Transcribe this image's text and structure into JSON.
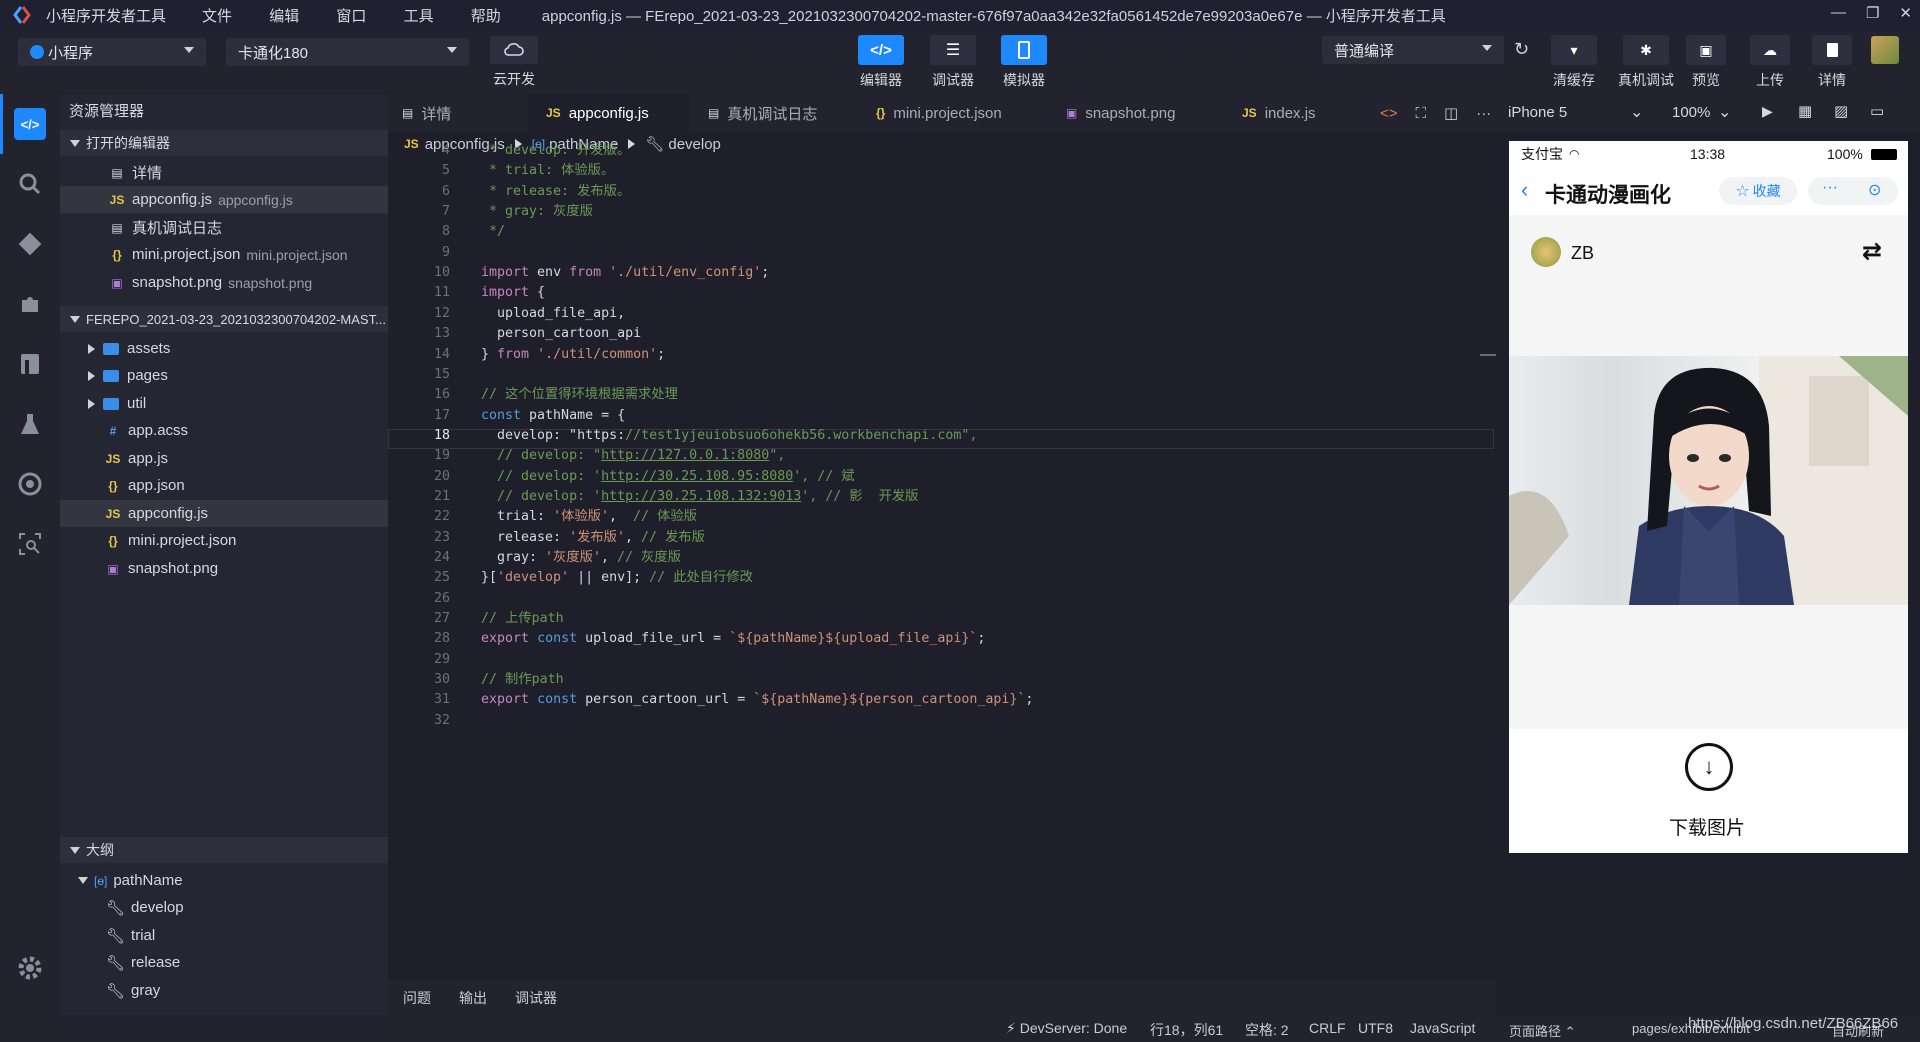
{
  "window": {
    "app_name": "小程序开发者工具",
    "menu": [
      "文件",
      "编辑",
      "窗口",
      "工具",
      "帮助"
    ],
    "title": "appconfig.js — FErepo_2021-03-23_2021032300704202-master-676f97a0aa342e32fa0561452de7e99203a0e67e — 小程序开发者工具"
  },
  "toolbar": {
    "project_type": "小程序",
    "project_name": "卡通化180",
    "cloud_label": "云开发",
    "editor_label": "编辑器",
    "debugger_label": "调试器",
    "simulator_label": "模拟器",
    "compile_mode": "普通编译",
    "clear_cache_label": "清缓存",
    "remote_debug_label": "真机调试",
    "preview_label": "预览",
    "upload_label": "上传",
    "details_label": "详情"
  },
  "explorer": {
    "title": "资源管理器",
    "open_editors_title": "打开的编辑器",
    "open_editors": [
      {
        "icon": "doc",
        "name": "详情",
        "sub": ""
      },
      {
        "icon": "JS",
        "name": "appconfig.js",
        "sub": "appconfig.js"
      },
      {
        "icon": "doc",
        "name": "真机调试日志",
        "sub": ""
      },
      {
        "icon": "{}",
        "name": "mini.project.json",
        "sub": "mini.project.json"
      },
      {
        "icon": "img",
        "name": "snapshot.png",
        "sub": "snapshot.png"
      }
    ],
    "project_title": "FEREPO_2021-03-23_2021032300704202-MAST...",
    "files": [
      {
        "icon": "folder",
        "name": "assets"
      },
      {
        "icon": "folder",
        "name": "pages"
      },
      {
        "icon": "folder",
        "name": "util"
      },
      {
        "icon": "#",
        "name": "app.acss"
      },
      {
        "icon": "JS",
        "name": "app.js"
      },
      {
        "icon": "{}",
        "name": "app.json"
      },
      {
        "icon": "JS",
        "name": "appconfig.js"
      },
      {
        "icon": "{}",
        "name": "mini.project.json"
      },
      {
        "icon": "img",
        "name": "snapshot.png"
      }
    ],
    "outline_title": "大纲",
    "outline_root": "pathName",
    "outline_items": [
      "develop",
      "trial",
      "release",
      "gray"
    ]
  },
  "tabs": [
    {
      "icon": "doc",
      "label": "详情"
    },
    {
      "icon": "JS",
      "label": "appconfig.js"
    },
    {
      "icon": "doc",
      "label": "真机调试日志"
    },
    {
      "icon": "{}",
      "label": "mini.project.json"
    },
    {
      "icon": "img",
      "label": "snapshot.png"
    },
    {
      "icon": "JS",
      "label": "index.js"
    }
  ],
  "breadcrumb": {
    "file": "appconfig.js",
    "symbol": "pathName",
    "prop": "develop"
  },
  "code": {
    "line_numbers": [
      "4",
      "5",
      "6",
      "7",
      "8",
      "9",
      "10",
      "11",
      "12",
      "13",
      "14",
      "15",
      "16",
      "17",
      "18",
      "19",
      "20",
      "21",
      "22",
      "23",
      "24",
      "25",
      "26",
      "27",
      "28",
      "29",
      "30",
      "31",
      "32"
    ],
    "current_line": "18",
    "lines": [
      " * develop: 开发版。",
      " * trial: 体验版。",
      " * release: 发布版。",
      " * gray: 灰度版",
      " */",
      "",
      "import env from './util/env_config';",
      "import {",
      "  upload_file_api,",
      "  person_cartoon_api",
      "} from './util/common';",
      "",
      "// 这个位置得环境根据需求处理",
      "const pathName = {",
      "  develop: \"https://test1yjeuiobsuo6ohekb56.workbenchapi.com\",",
      "  // develop: \"http://127.0.0.1:8080\",",
      "  // develop: 'http://30.25.108.95:8080', // 斌",
      "  // develop: 'http://30.25.108.132:9013', // 影  开发版",
      "  trial: '体验版',  // 体验版",
      "  release: '发布版', // 发布版",
      "  gray: '灰度版', // 灰度版",
      "}['develop' || env]; // 此处自行修改",
      "",
      "// 上传path",
      "export const upload_file_url = `${pathName}${upload_file_api}`;",
      "",
      "// 制作path",
      "export const person_cartoon_url = `${pathName}${person_cartoon_api}`;",
      ""
    ]
  },
  "panel": {
    "tabs": [
      "问题",
      "输出",
      "调试器"
    ]
  },
  "simulator": {
    "device": "iPhone 5",
    "zoom": "100%",
    "carrier": "支付宝",
    "time": "13:38",
    "battery": "100%",
    "page_title": "卡通动漫画化",
    "favorite_label": "收藏",
    "user_name": "ZB",
    "download_label": "下载图片"
  },
  "statusbar": {
    "devserver": "DevServer: Done",
    "position": "行18，列61",
    "spaces": "空格: 2",
    "eol": "CRLF",
    "encoding": "UTF8",
    "language": "JavaScript",
    "page_path_label": "页面路径",
    "page_path": "pages/exhibit/exhibit",
    "auto_refresh": "自动刷新",
    "watermark": "https://blog.csdn.net/ZB66ZB66"
  }
}
